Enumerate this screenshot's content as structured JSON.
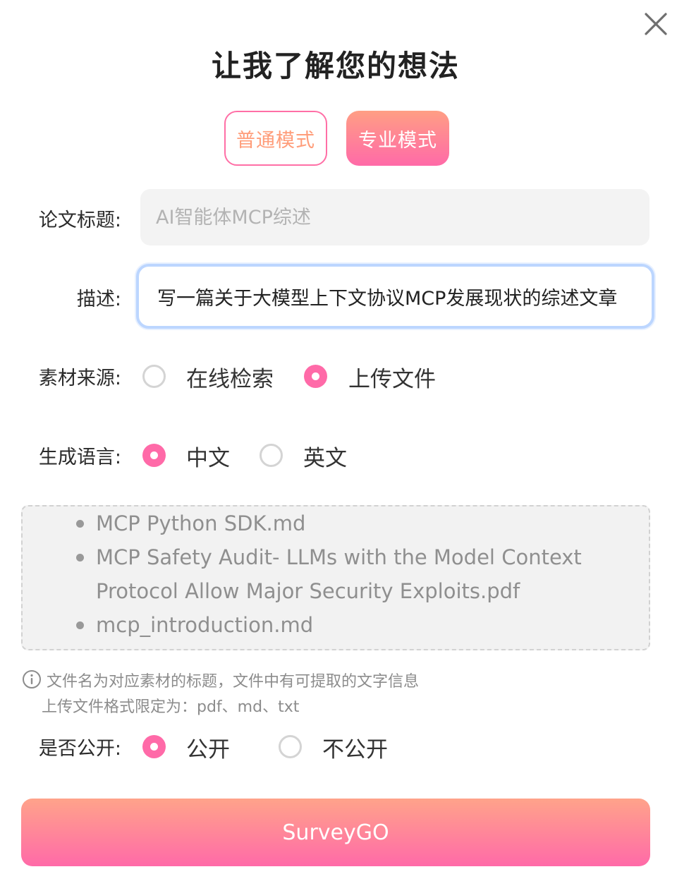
{
  "dialog": {
    "title": "让我了解您的想法",
    "close_icon": "close-icon"
  },
  "modes": {
    "normal_label": "普通模式",
    "pro_label": "专业模式",
    "selected": "专业模式"
  },
  "form": {
    "paper_title": {
      "label": "论文标题:",
      "value": "",
      "placeholder": "AI智能体MCP综述"
    },
    "description": {
      "label": "描述:",
      "value": "写一篇关于大模型上下文协议MCP发展现状的综述文章"
    },
    "source": {
      "label": "素材来源:",
      "options": [
        "在线检索",
        "上传文件"
      ],
      "selected": "上传文件"
    },
    "language": {
      "label": "生成语言:",
      "options": [
        "中文",
        "英文"
      ],
      "selected": "中文"
    },
    "files": [
      "MCP Python SDK.md",
      "MCP Safety Audit- LLMs with the Model Context",
      "Protocol Allow Major Security Exploits.pdf",
      "mcp_introduction.md"
    ],
    "hint": {
      "icon": "info-icon",
      "line1": "文件名为对应素材的标题，文件中有可提取的文字信息",
      "line2": "上传文件格式限定为：pdf、md、txt"
    },
    "public": {
      "label": "是否公开:",
      "options": [
        "公开",
        "不公开"
      ],
      "selected": "公开"
    }
  },
  "submit_label": "SurveyGO",
  "colors": {
    "accent_pink": "#ff6aa8",
    "accent_peach": "#ff9e84",
    "focus_border": "#bcd6ff"
  }
}
